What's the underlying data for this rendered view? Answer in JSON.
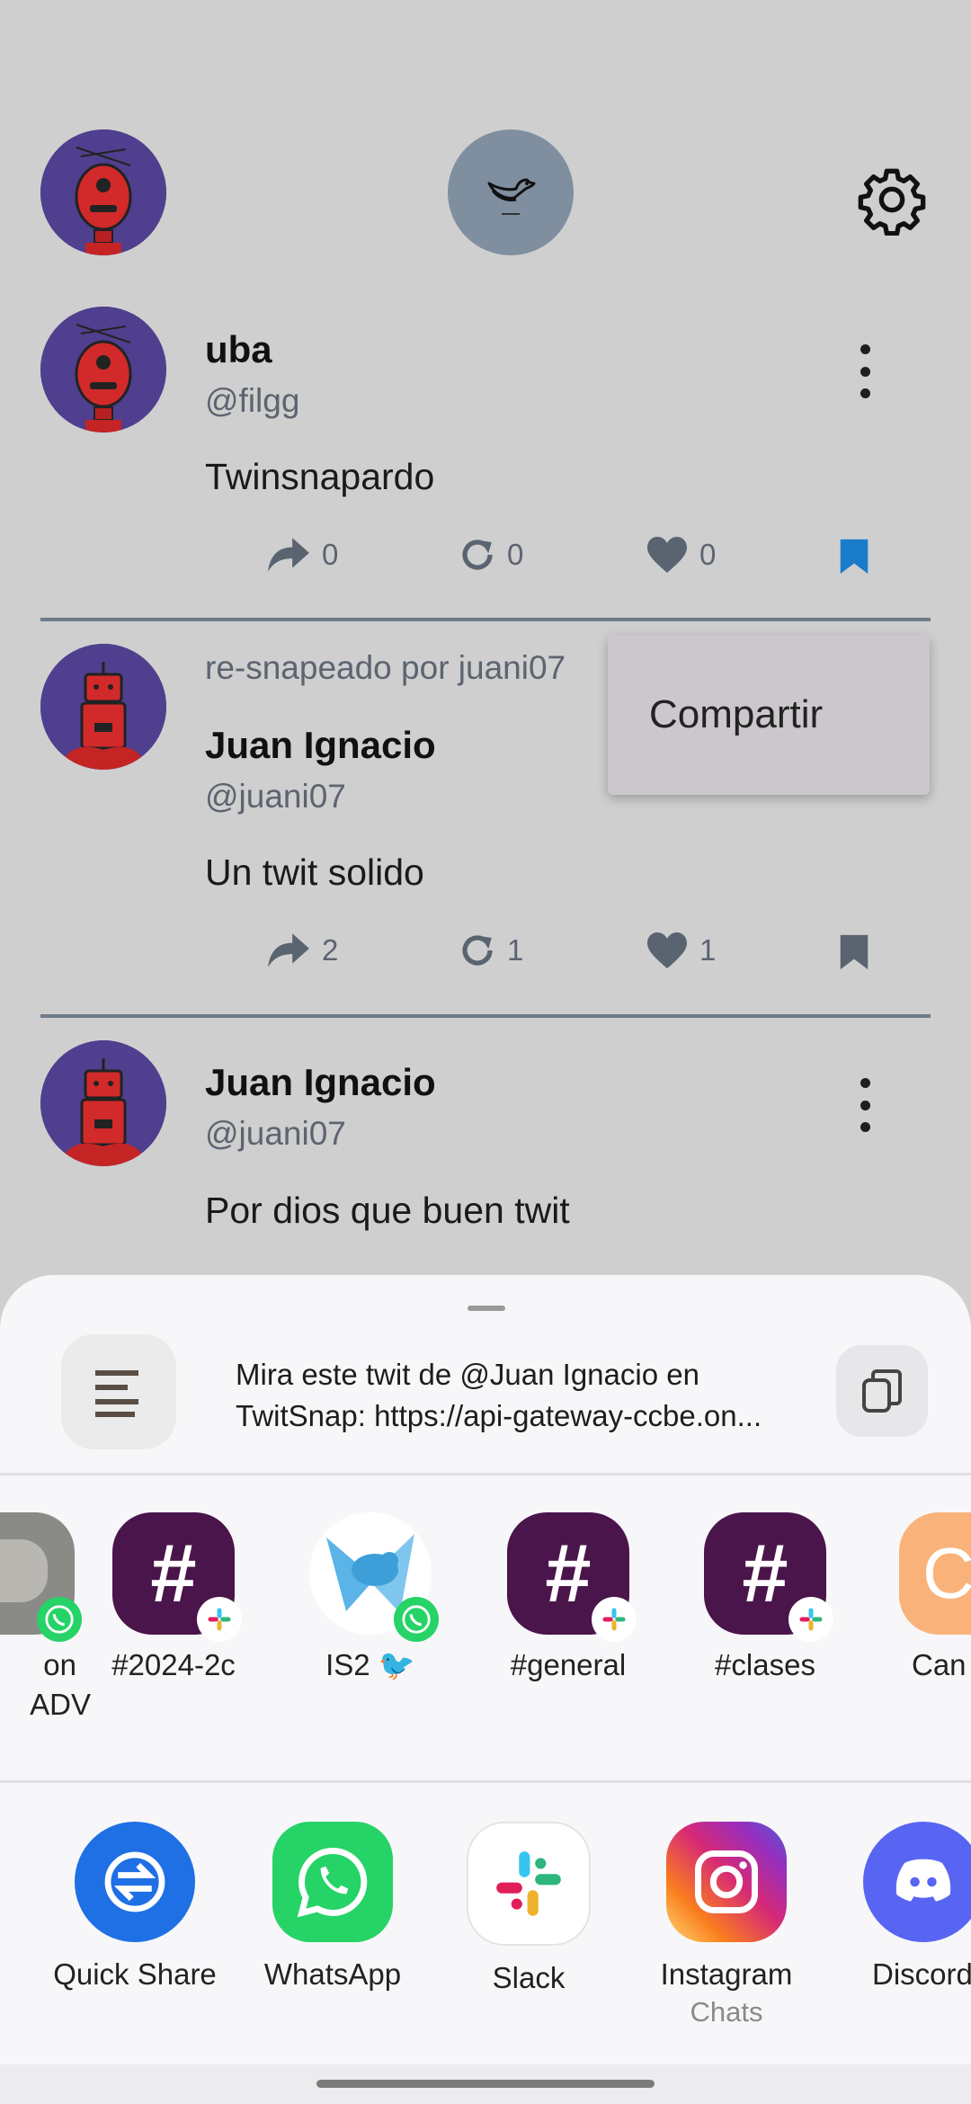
{
  "posts": [
    {
      "name": "uba",
      "handle": "@filgg",
      "text": "Twinsnapardo",
      "shares": "0",
      "resnaps": "0",
      "likes": "0",
      "bookmarked": true
    },
    {
      "resnap_by": "re-snapeado por juani07",
      "name": "Juan Ignacio",
      "handle": "@juani07",
      "text": "Un twit solido",
      "shares": "2",
      "resnaps": "1",
      "likes": "1",
      "bookmarked": false
    },
    {
      "name": "Juan Ignacio",
      "handle": "@juani07",
      "text": "Por dios que buen twit"
    }
  ],
  "context_menu": {
    "share_label": "Compartir"
  },
  "share_sheet": {
    "preview_line1": "Mira este twit de @Juan Ignacio en",
    "preview_line2": "TwitSnap: https://api-gateway-ccbe.on...",
    "direct_targets": [
      {
        "label_line1": "on",
        "label_line2": "ADV",
        "icon": "photo-contact-icon",
        "badge": "whatsapp"
      },
      {
        "label": "#2024-2c",
        "icon": "slack-channel-icon",
        "badge": "slack"
      },
      {
        "label": "IS2 🐦",
        "icon": "bird-group-icon",
        "badge": "whatsapp"
      },
      {
        "label": "#general",
        "icon": "slack-channel-icon",
        "badge": "slack"
      },
      {
        "label": "#clases",
        "icon": "slack-channel-icon",
        "badge": "slack"
      },
      {
        "label": "Can",
        "icon": "orange-app-icon"
      }
    ],
    "apps": [
      {
        "label": "Quick Share",
        "icon": "quick-share-icon"
      },
      {
        "label": "WhatsApp",
        "icon": "whatsapp-icon"
      },
      {
        "label": "Slack",
        "icon": "slack-icon"
      },
      {
        "label": "Instagram",
        "sub": "Chats",
        "icon": "instagram-icon"
      },
      {
        "label": "Discord",
        "icon": "discord-icon"
      }
    ]
  },
  "colors": {
    "background": "#cfcfcf",
    "bookmark_active": "#1a7bc8",
    "slack_purple": "#4a154b",
    "whatsapp_green": "#25d366",
    "quickshare_blue": "#1f6fe5",
    "discord_blurple": "#5865f2"
  }
}
